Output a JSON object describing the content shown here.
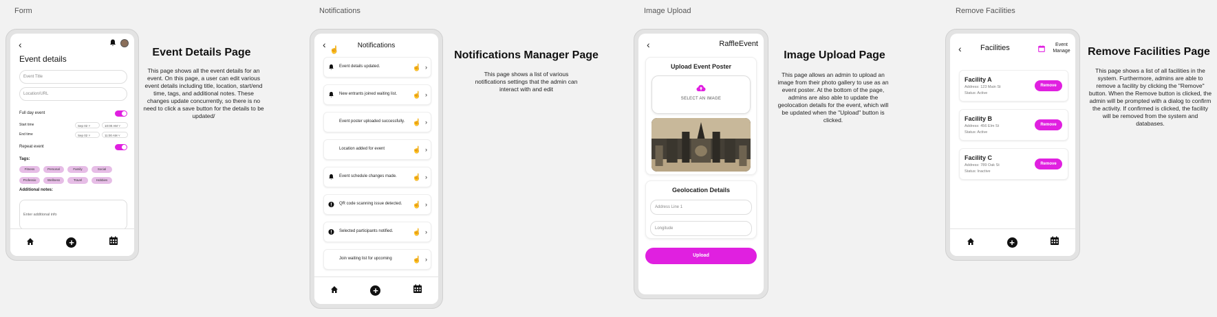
{
  "sections": {
    "form": "Form",
    "notifications": "Notifications",
    "image_upload": "Image Upload",
    "remove_facilities": "Remove Facilities"
  },
  "event_details": {
    "title": "Event details",
    "event_title_placeholder": "Event Title",
    "location_placeholder": "Location/URL",
    "full_day_label": "Full day event",
    "start_time_label": "Start time",
    "end_time_label": "End time",
    "start_date": "Sep 02",
    "start_time": "10:00 AM",
    "end_date": "Sep 02",
    "end_time": "11:00 AM",
    "repeat_label": "Repeat event",
    "tags_label": "Tags:",
    "tags": [
      "Fitness",
      "Personal",
      "Family",
      "Social",
      "Professio",
      "Wellness",
      "Travel",
      "Hobbies"
    ],
    "notes_label": "Additional notes:",
    "notes_placeholder": "Enter additional info",
    "desc_title": "Event Details Page",
    "desc_text": "This page shows all the event details for an event. On this page, a user can edit various event details including title, location, start/end time, tags, and additional notes. These changes update concurrently, so there is no need to click a save button for the details to be updated/"
  },
  "notifications": {
    "title": "Notifications",
    "items": [
      {
        "text": "Event details updated.",
        "icon": "bell-icon"
      },
      {
        "text": "New entrants joined waiting list.",
        "icon": "bell-icon"
      },
      {
        "text": "Event poster uploaded successfully.",
        "icon": "none"
      },
      {
        "text": "Location added for event",
        "icon": "none"
      },
      {
        "text": "Event schedule changes made.",
        "icon": "bell-icon"
      },
      {
        "text": "QR code scanning issue detected.",
        "icon": "alert-icon"
      },
      {
        "text": "Selected participants notified.",
        "icon": "alert-icon"
      },
      {
        "text": "Join waiting list for upcoming",
        "icon": "none"
      }
    ],
    "desc_title": "Notifications Manager Page",
    "desc_text": "This page shows a list of various notifications settings that the admin can interact with and edit"
  },
  "image_upload": {
    "app_title": "RaffleEvent",
    "upload_heading": "Upload Event Poster",
    "select_label": "SELECT AN IMAGE",
    "geo_heading": "Geolocation Details",
    "address_placeholder": "Address Line 1",
    "longitude_placeholder": "Longitude",
    "upload_button": "Upload",
    "desc_title": "Image Upload Page",
    "desc_text": "This page allows an admin to upload an image from their photo gallery to use as an event poster. At the bottom of the page, admins are also able to update the geolocation details for the event, which will be updated when the \"Upload\" button is clicked."
  },
  "facilities": {
    "title": "Facilities",
    "manage_label": "Event Manage",
    "items": [
      {
        "name": "Facility A",
        "address": "Address: 123 Main St",
        "status": "Status: Active"
      },
      {
        "name": "Facility B",
        "address": "Address: 456 Elm St",
        "status": "Status: Active"
      },
      {
        "name": "Facility C",
        "address": "Address: 789 Oak St",
        "status": "Status: Inactive"
      }
    ],
    "remove_label": "Remove",
    "desc_title": "Remove Facilities Page",
    "desc_text": "This page shows a list of all facilities in the system. Furthermore, admins are able to remove a facility by clicking the \"Remove\" button. When the Remove button is clicked, the admin will be prompted with a dialog to confirm the activity. If confirmed is clicked, the facility will be removed from the system and databases."
  },
  "colors": {
    "accent": "#e020e0",
    "tag": "#e6bde6"
  }
}
